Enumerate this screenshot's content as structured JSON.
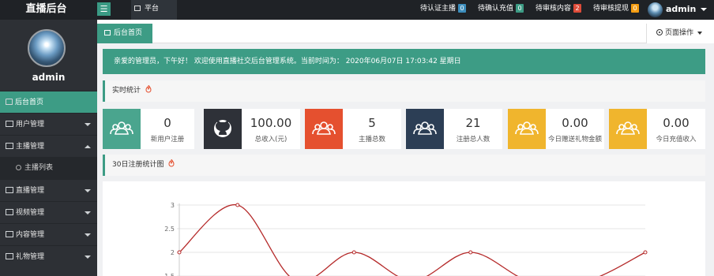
{
  "brand": "直播后台",
  "top_tab": "平台",
  "pending": [
    {
      "label": "待认证主播",
      "count": "0",
      "color": "#3c8dbc"
    },
    {
      "label": "待确认充值",
      "count": "0",
      "color": "#3d9c85"
    },
    {
      "label": "待审核内容",
      "count": "2",
      "color": "#dd4b39"
    },
    {
      "label": "待审核提现",
      "count": "0",
      "color": "#f39c12"
    }
  ],
  "user": {
    "name": "admin"
  },
  "sidebar": {
    "username": "admin",
    "items": [
      {
        "label": "后台首页"
      },
      {
        "label": "用户管理"
      },
      {
        "label": "主播管理"
      },
      {
        "label": "主播列表"
      },
      {
        "label": "直播管理"
      },
      {
        "label": "视频管理"
      },
      {
        "label": "内容管理"
      },
      {
        "label": "礼物管理"
      }
    ]
  },
  "tabs": {
    "home": "后台首页",
    "page_ops": "页面操作"
  },
  "welcome": "亲爱的管理员，下午好！ 欢迎使用直播社交后台管理系统。当前时间为： 2020年06月07日 17:03:42   星期日",
  "realtime": {
    "title": "实时统计"
  },
  "stats": [
    {
      "value": "0",
      "label": "新用户注册",
      "color": "#4aa58e",
      "icon": "users-icon"
    },
    {
      "value": "100.00",
      "label": "总收入(元)",
      "color": "#2e3138",
      "icon": "github-icon"
    },
    {
      "value": "5",
      "label": "主播总数",
      "color": "#e5502f",
      "icon": "users-icon"
    },
    {
      "value": "21",
      "label": "注册总人数",
      "color": "#2c3e55",
      "icon": "users-icon"
    },
    {
      "value": "0.00",
      "label": "今日赠送礼物金额",
      "color": "#f0b52d",
      "icon": "users-icon"
    },
    {
      "value": "0.00",
      "label": "今日充值收入",
      "color": "#f0b52d",
      "icon": "users-icon"
    }
  ],
  "chart_section": {
    "title": "30日注册统计图"
  },
  "chart_data": {
    "type": "line",
    "ytick_labels": [
      "3",
      "2.5",
      "2",
      "1.5"
    ],
    "ylim": [
      1.5,
      3
    ],
    "points": [
      {
        "x": 0,
        "y": 2.0
      },
      {
        "x": 1,
        "y": 3.0
      },
      {
        "x": 2,
        "y": 1.4
      },
      {
        "x": 3,
        "y": 2.0
      },
      {
        "x": 4,
        "y": 1.4
      },
      {
        "x": 5,
        "y": 2.0
      },
      {
        "x": 6,
        "y": 1.4
      },
      {
        "x": 7,
        "y": 1.4
      },
      {
        "x": 8,
        "y": 2.0
      }
    ],
    "visible_markers": [
      0,
      1,
      3,
      5,
      8
    ],
    "line_color": "#b52a2a",
    "grid": true
  }
}
